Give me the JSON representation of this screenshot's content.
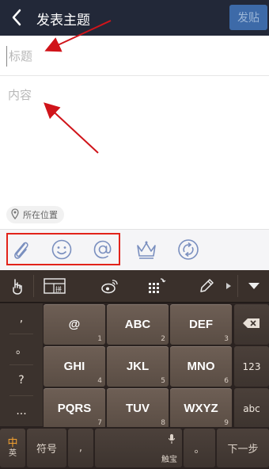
{
  "header": {
    "title": "发表主题",
    "post_label": "发贴"
  },
  "form": {
    "title_placeholder": "标题",
    "content_placeholder": "内容",
    "location_label": "所在位置"
  },
  "keyboard": {
    "symbols": [
      ",",
      "。",
      "?",
      "..."
    ],
    "keys": [
      {
        "main": "@",
        "num": "1"
      },
      {
        "main": "ABC",
        "num": "2"
      },
      {
        "main": "DEF",
        "num": "3"
      },
      {
        "main": "GHI",
        "num": "4"
      },
      {
        "main": "JKL",
        "num": "5"
      },
      {
        "main": "MNO",
        "num": "6"
      },
      {
        "main": "PQRS",
        "num": "7"
      },
      {
        "main": "TUV",
        "num": "8"
      },
      {
        "main": "WXYZ",
        "num": "9"
      }
    ],
    "side": {
      "num_label": "123",
      "abc_label": "abc"
    },
    "bottom": {
      "lang_main": "中",
      "lang_sub": "英",
      "symbol_label": "符号",
      "comma": ",",
      "space_sub": "触宝",
      "period": "。",
      "next_label": "下一步"
    }
  },
  "colors": {
    "header_bg": "#222838",
    "post_btn_bg": "#3d6aa8",
    "highlight_border": "#e2231a",
    "annotation_arrow": "#d0141a",
    "lang_active": "#f2a030"
  },
  "icons": [
    "back-arrow-icon",
    "location-pin-icon",
    "paperclip-icon",
    "smiley-icon",
    "at-sign-icon",
    "crown-icon",
    "refresh-icon",
    "hand-pointer-icon",
    "layout-icon",
    "weibo-icon",
    "grid-icon",
    "pencil-icon",
    "dropdown-icon",
    "backspace-icon",
    "microphone-icon"
  ]
}
